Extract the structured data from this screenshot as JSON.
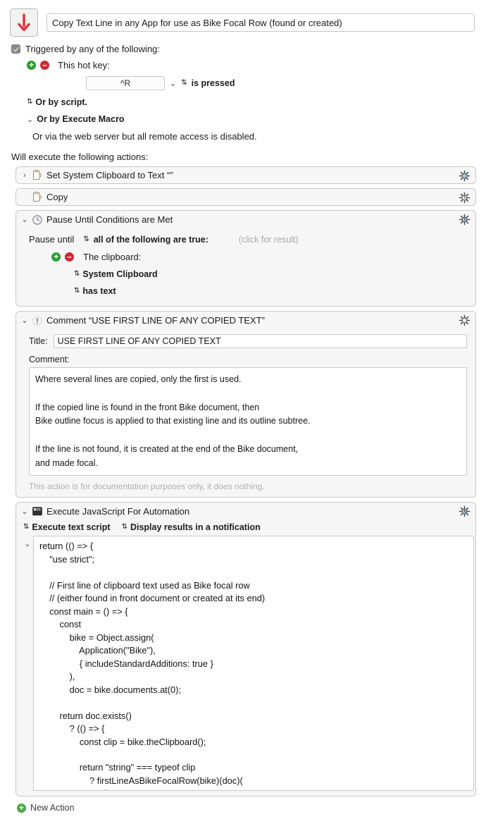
{
  "header": {
    "icon": "red-down-arrow-icon",
    "macro_name": "Copy Text Line in any App for use as Bike Focal Row (found or created)"
  },
  "triggers": {
    "checkbox_label": "Triggered by any of the following:",
    "checked": true,
    "hotkey_label": "This hot key:",
    "hotkey_value": "^R",
    "hotkey_condition": "is pressed",
    "or_by_script": "Or by script.",
    "or_by_execute_macro": "Or by Execute Macro",
    "web_server_note": "Or via the web server but all remote access is disabled."
  },
  "actions_intro": "Will execute the following actions:",
  "actions": [
    {
      "id": "set-clipboard",
      "title": "Set System Clipboard to Text “”",
      "icon": "clipboard-icon",
      "disclosure": "›",
      "gear": "gear-icon",
      "gear_variant": "blue"
    },
    {
      "id": "copy",
      "title": "Copy",
      "icon": "clipboard-icon",
      "disclosure": "",
      "gear": "gear-clock-icon",
      "gear_variant": "plain"
    },
    {
      "id": "pause-until",
      "title": "Pause Until Conditions are Met",
      "icon": "clock-icon",
      "disclosure": "⌄",
      "gear": "gear-clock-icon",
      "gear_variant": "blue",
      "body": {
        "pause_until_label": "Pause until",
        "condition_mode": "all of the following are true:",
        "click_for_result": "(click for result)",
        "clipboard_label": "The clipboard:",
        "source": "System Clipboard",
        "test": "has text"
      }
    },
    {
      "id": "comment",
      "title": "Comment “USE FIRST LINE OF ANY COPIED TEXT”",
      "icon": "exclamation-icon",
      "disclosure": "⌄",
      "gear": "gear-icon",
      "gear_variant": "plain",
      "body": {
        "title_label": "Title:",
        "title_value": "USE FIRST LINE OF ANY COPIED TEXT",
        "comment_label": "Comment:",
        "comment_value": "Where several lines are copied, only the first is used.\n\nIf the copied line is found in the front Bike document, then\nBike outline focus is applied to that existing line and its outline subtree.\n\nIf the line is not found, it is created at the end of the Bike document,\nand made focal.",
        "footer_note": "This action is for documentation purposes only, it does nothing."
      }
    },
    {
      "id": "execute-jxa",
      "title": "Execute JavaScript For Automation",
      "icon": "script-monitor-icon",
      "disclosure": "⌄",
      "gear": "gear-clock-icon",
      "gear_variant": "blue",
      "body": {
        "option_source": "Execute text script",
        "option_result": "Display results in a notification",
        "script_disclosure": "⌄",
        "script": "return (() => {\n    \"use strict\";\n\n    // First line of clipboard text used as Bike focal row\n    // (either found in front document or created at its end)\n    const main = () => {\n        const\n            bike = Object.assign(\n                Application(\"Bike\"),\n                { includeStandardAdditions: true }\n            ),\n            doc = bike.documents.at(0);\n\n        return doc.exists()\n            ? (() => {\n                const clip = bike.theClipboard();\n\n                return \"string\" === typeof clip\n                    ? firstLineAsBikeFocalRow(bike)(doc)(\n                        clip\n                    )"
      }
    }
  ],
  "footer": {
    "new_action_label": "New Action"
  },
  "colors": {
    "accent_green": "#27a02a",
    "accent_red": "#cf2a32",
    "arrow_red": "#e8262a",
    "gear_blue": "#9fcdea",
    "muted": "#a9a9a9"
  }
}
